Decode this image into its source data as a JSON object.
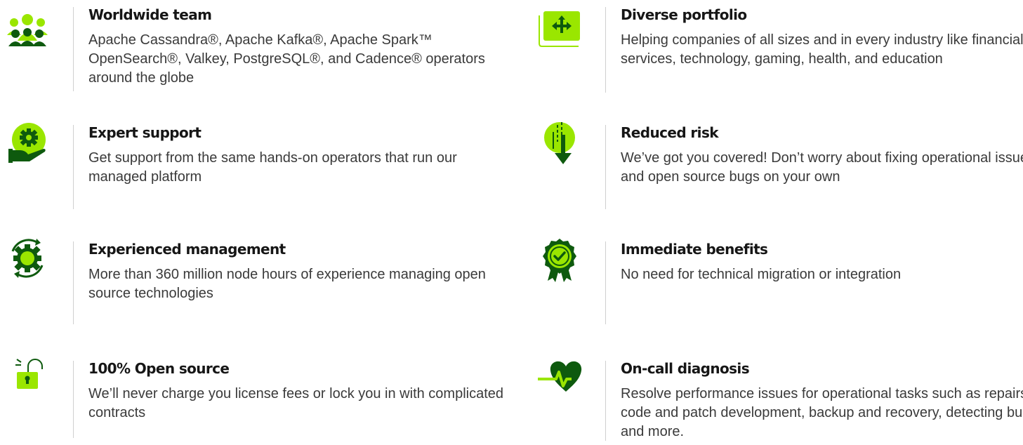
{
  "colors": {
    "accent": "#9ae600",
    "accent_dark": "#0e5a0e",
    "text": "#161616",
    "muted": "#3a3a3a",
    "divider": "#cfcfcf"
  },
  "features": {
    "worldwide_team": {
      "icon": "team-icon",
      "title": "Worldwide team",
      "description": "Apache Cassandra®, Apache Kafka®, Apache Spark™ OpenSearch®, Valkey, PostgreSQL®, and Cadence® operators around the globe"
    },
    "diverse_portfolio": {
      "icon": "move-arrows-icon",
      "title": "Diverse portfolio",
      "description": "Helping companies of all sizes and in every industry like financial services, technology, gaming, health, and education"
    },
    "expert_support": {
      "icon": "gear-hand-icon",
      "title": "Expert support",
      "description": "Get support from the same hands-on operators that run our managed platform"
    },
    "reduced_risk": {
      "icon": "download-arrow-icon",
      "title": "Reduced risk",
      "description": "We’ve got you covered! Don’t worry about fixing operational issues and open source bugs on your own"
    },
    "experienced_management": {
      "icon": "gear-cycle-icon",
      "title": "Experienced management",
      "description": "More than 360 million node hours of experience managing open source technologies"
    },
    "immediate_benefits": {
      "icon": "award-check-icon",
      "title": "Immediate benefits",
      "description": "No need for technical migration or integration"
    },
    "open_source": {
      "icon": "open-lock-icon",
      "title": "100% Open source",
      "description": "We’ll never charge you license fees or lock you in with complicated contracts"
    },
    "on_call_diagnosis": {
      "icon": "heartbeat-icon",
      "title": "On-call diagnosis",
      "description": "Resolve performance issues for operational tasks such as repairs, code and patch development, backup and recovery, detecting bugs, and more."
    }
  }
}
